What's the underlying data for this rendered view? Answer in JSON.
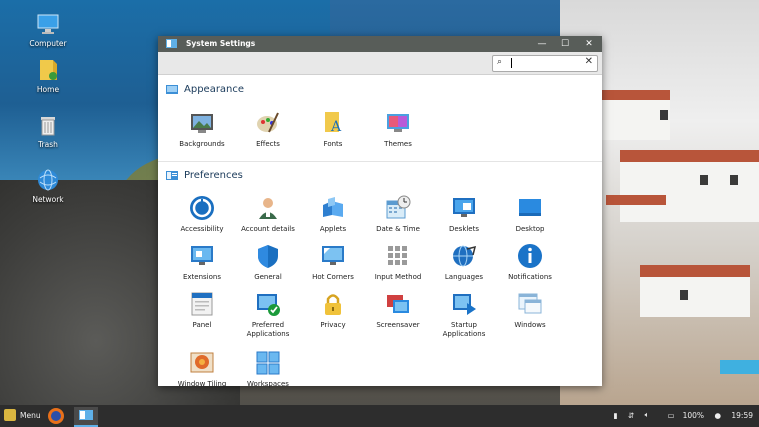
{
  "desktop": {
    "icons": [
      {
        "label": "Computer",
        "icon": "computer-icon"
      },
      {
        "label": "Home",
        "icon": "home-folder-icon"
      },
      {
        "label": "Trash",
        "icon": "trash-icon"
      },
      {
        "label": "Network",
        "icon": "network-icon"
      }
    ]
  },
  "window": {
    "title": "System Settings",
    "controls": {
      "minimize": "—",
      "maximize": "☐",
      "close": "✕"
    },
    "search": {
      "value": "",
      "placeholder": ""
    }
  },
  "sections": {
    "appearance": {
      "title": "Appearance",
      "items": [
        {
          "label": "Backgrounds",
          "icon": "backgrounds-icon"
        },
        {
          "label": "Effects",
          "icon": "effects-icon"
        },
        {
          "label": "Fonts",
          "icon": "fonts-icon"
        },
        {
          "label": "Themes",
          "icon": "themes-icon"
        }
      ]
    },
    "preferences": {
      "title": "Preferences",
      "items": [
        {
          "label": "Accessibility",
          "icon": "accessibility-icon"
        },
        {
          "label": "Account details",
          "icon": "account-details-icon"
        },
        {
          "label": "Applets",
          "icon": "applets-icon"
        },
        {
          "label": "Date & Time",
          "icon": "date-time-icon"
        },
        {
          "label": "Desklets",
          "icon": "desklets-icon"
        },
        {
          "label": "Desktop",
          "icon": "desktop-icon"
        },
        {
          "label": "Extensions",
          "icon": "extensions-icon"
        },
        {
          "label": "General",
          "icon": "general-icon"
        },
        {
          "label": "Hot Corners",
          "icon": "hot-corners-icon"
        },
        {
          "label": "Input Method",
          "icon": "input-method-icon"
        },
        {
          "label": "Languages",
          "icon": "languages-icon"
        },
        {
          "label": "Notifications",
          "icon": "notifications-icon"
        },
        {
          "label": "Panel",
          "icon": "panel-icon"
        },
        {
          "label": "Preferred Applications",
          "icon": "preferred-applications-icon"
        },
        {
          "label": "Privacy",
          "icon": "privacy-icon"
        },
        {
          "label": "Screensaver",
          "icon": "screensaver-icon"
        },
        {
          "label": "Startup Applications",
          "icon": "startup-applications-icon"
        },
        {
          "label": "Windows",
          "icon": "windows-icon"
        },
        {
          "label": "Window Tiling",
          "icon": "window-tiling-icon"
        },
        {
          "label": "Workspaces",
          "icon": "workspaces-icon"
        }
      ]
    }
  },
  "taskbar": {
    "menu_label": "Menu",
    "apps": [
      {
        "icon": "firefox-icon"
      },
      {
        "icon": "system-settings-icon"
      }
    ],
    "tray": {
      "battery": "100%",
      "clock": "19:59"
    }
  },
  "colors": {
    "titlebar": "#585d59",
    "accent_blue": "#1a73c8",
    "taskbar": "#2d2d2d"
  }
}
